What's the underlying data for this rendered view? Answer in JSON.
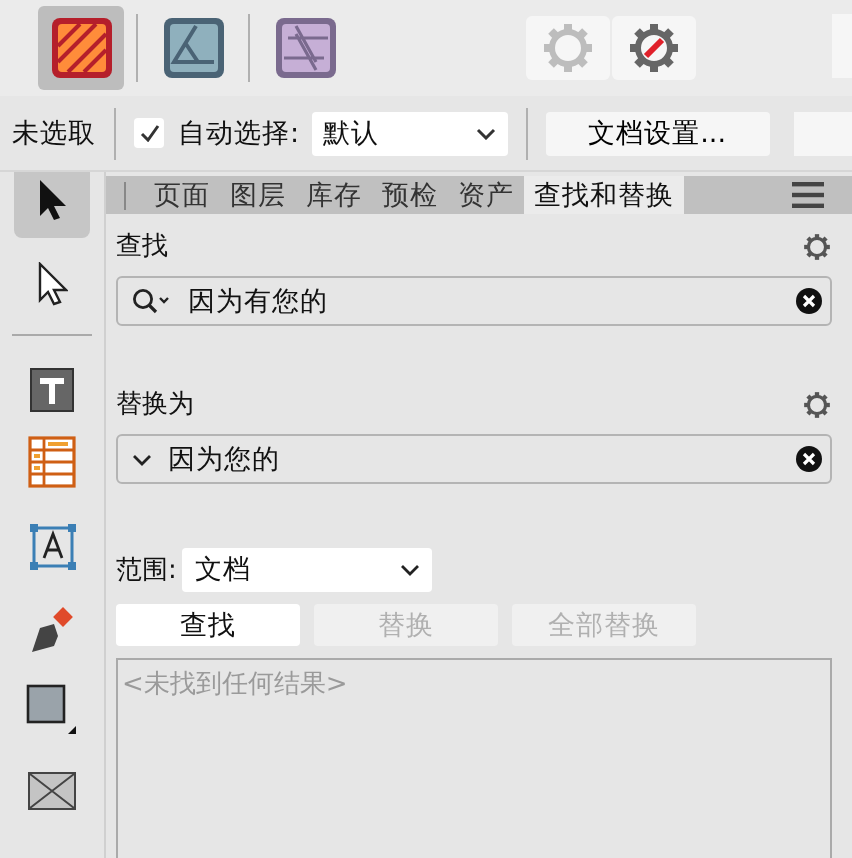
{
  "apps": [
    {
      "kind": "publisher",
      "selected": true
    },
    {
      "kind": "designer",
      "selected": false
    },
    {
      "kind": "photo",
      "selected": false
    }
  ],
  "context_bar": {
    "selection": "未选取",
    "auto_select": {
      "checked": true,
      "label": "自动选择:",
      "value": "默认"
    },
    "document_setup": "文档设置..."
  },
  "tools": [
    {
      "kind": "move",
      "selected": true
    },
    {
      "kind": "node",
      "selected": false
    },
    {
      "kind": "divider"
    },
    {
      "kind": "text-frame",
      "selected": false
    },
    {
      "kind": "table",
      "selected": false
    },
    {
      "kind": "artistic-text",
      "selected": false
    },
    {
      "kind": "pen",
      "selected": false
    },
    {
      "kind": "shape",
      "selected": false
    },
    {
      "kind": "picture-frame",
      "selected": false
    }
  ],
  "tabs": [
    {
      "label": "页面",
      "selected": false
    },
    {
      "label": "图层",
      "selected": false
    },
    {
      "label": "库存",
      "selected": false
    },
    {
      "label": "预检",
      "selected": false
    },
    {
      "label": "资产",
      "selected": false
    },
    {
      "label": "查找和替换",
      "selected": true
    }
  ],
  "find": {
    "label": "查找",
    "value": "因为有您的"
  },
  "replace": {
    "label": "替换为",
    "value": "因为您的"
  },
  "scope": {
    "label": "范围:",
    "value": "文档"
  },
  "buttons": [
    {
      "label": "查找",
      "disabled": false
    },
    {
      "label": "替换",
      "disabled": true
    },
    {
      "label": "全部替换",
      "disabled": true
    }
  ],
  "results": {
    "placeholder": "<未找到任何结果>"
  }
}
